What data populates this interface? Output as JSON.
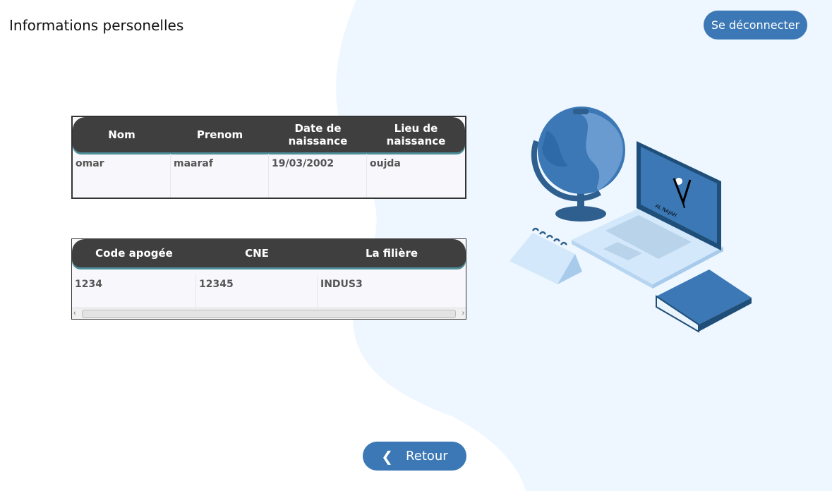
{
  "header": {
    "title": "Informations personelles",
    "logout_label": "Se déconnecter"
  },
  "personal_table": {
    "columns": [
      "Nom",
      "Prenom",
      "Date de naissance",
      "Lieu de naissance"
    ],
    "rows": [
      [
        "omar",
        "maaraf",
        "19/03/2002",
        "oujda"
      ]
    ]
  },
  "school_table": {
    "columns": [
      "Code apogée",
      "CNE",
      "La filière"
    ],
    "rows": [
      [
        "1234",
        "12345",
        "INDUS3"
      ]
    ]
  },
  "illustration": {
    "laptop_logo_text": "AL NAJAH"
  },
  "footer": {
    "back_label": "Retour",
    "back_icon": "chevron-left-icon"
  },
  "colors": {
    "accent": "#3b78b5",
    "header_bg": "#3f3f3f",
    "blob": "#eef7ff"
  }
}
